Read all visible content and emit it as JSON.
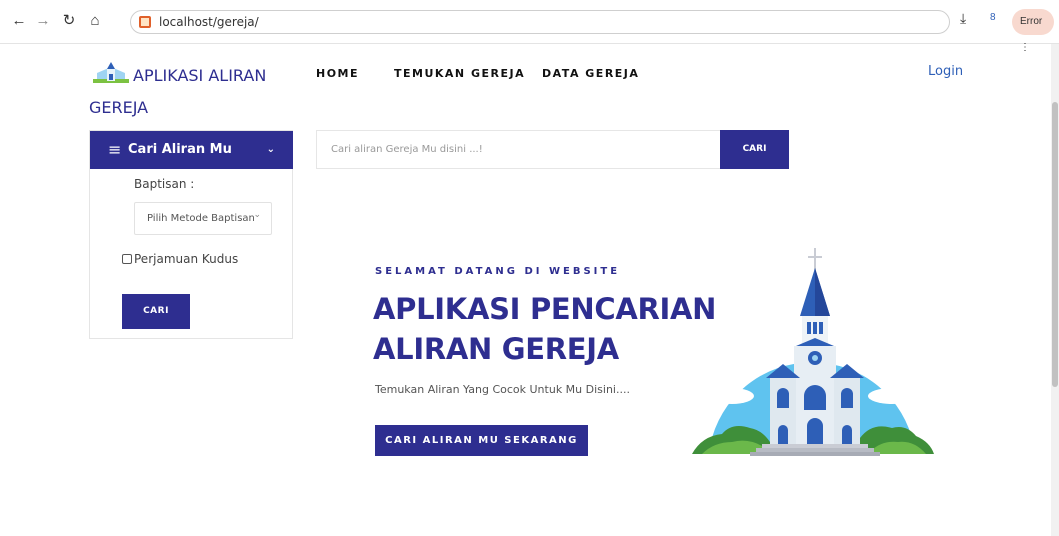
{
  "browser": {
    "url": "localhost/gereja/",
    "profile_label": "Error",
    "back_icon": "arrow-left-icon",
    "forward_icon": "arrow-right-icon",
    "reload_icon": "reload-icon",
    "home_icon": "home-icon",
    "download_icon": "download-icon",
    "extension_icon": "extension-icon"
  },
  "header": {
    "brand_line1": "APLIKASI ALIRAN",
    "brand_line2": "GEREJA",
    "nav": [
      "HOME",
      "TEMUKAN GEREJA",
      "DATA GEREJA"
    ],
    "login_label": "Login"
  },
  "sidebar": {
    "title": "Cari Aliran Mu",
    "baptisan_label": "Baptisan :",
    "select_value": "Pilih Metode Baptisan",
    "checkbox_label": "Perjamuan Kudus",
    "checkbox_checked": false,
    "button_label": "CARI"
  },
  "search": {
    "placeholder": "Cari aliran Gereja Mu disini ...!",
    "button_label": "CARI"
  },
  "hero": {
    "welcome": "SELAMAT DATANG DI WEBSITE",
    "title_line1": "APLIKASI PENCARIAN",
    "title_line2": "ALIRAN GEREJA",
    "subtitle": "Temukan Aliran Yang Cocok Untuk Mu Disini....",
    "button_label": "CARI ALIRAN MU SEKARANG",
    "illustration": "church-illustration"
  },
  "colors": {
    "primary": "#2e2e90",
    "link": "#2e5fb7",
    "sky": "#5fc3ef"
  }
}
